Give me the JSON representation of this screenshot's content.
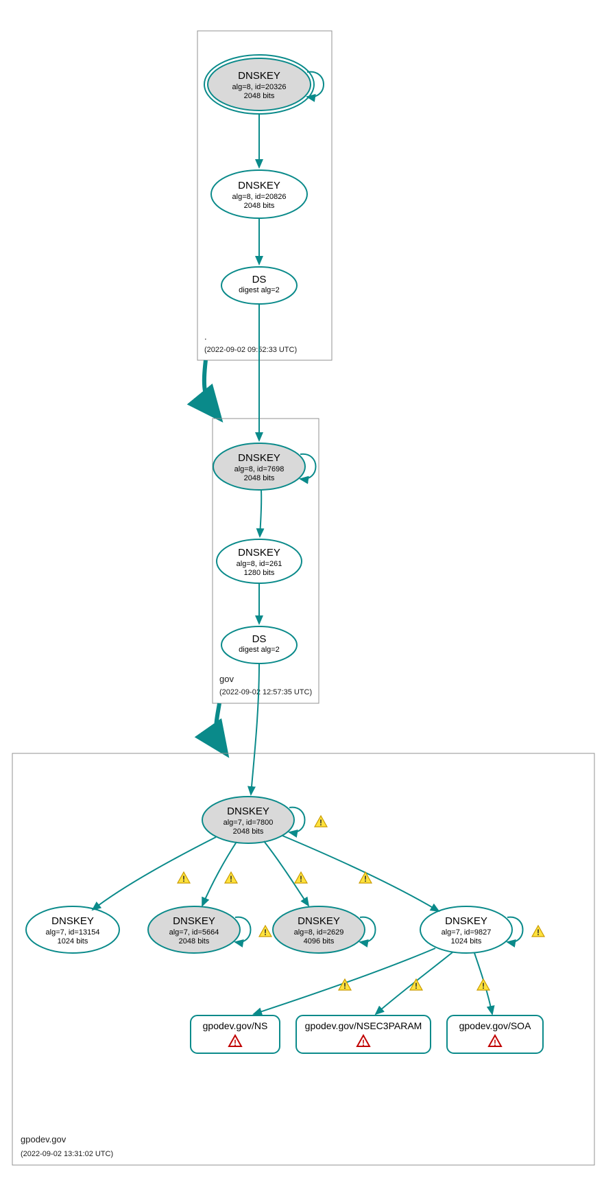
{
  "zones": {
    "root": {
      "name": ".",
      "timestamp": "(2022-09-02 09:52:33 UTC)"
    },
    "gov": {
      "name": "gov",
      "timestamp": "(2022-09-02 12:57:35 UTC)"
    },
    "domain": {
      "name": "gpodev.gov",
      "timestamp": "(2022-09-02 13:31:02 UTC)"
    }
  },
  "nodes": {
    "root_ksk": {
      "title": "DNSKEY",
      "line1": "alg=8, id=20326",
      "line2": "2048 bits"
    },
    "root_zsk": {
      "title": "DNSKEY",
      "line1": "alg=8, id=20826",
      "line2": "2048 bits"
    },
    "root_ds": {
      "title": "DS",
      "line1": "digest alg=2",
      "line2": ""
    },
    "gov_ksk": {
      "title": "DNSKEY",
      "line1": "alg=8, id=7698",
      "line2": "2048 bits"
    },
    "gov_zsk": {
      "title": "DNSKEY",
      "line1": "alg=8, id=261",
      "line2": "1280 bits"
    },
    "gov_ds": {
      "title": "DS",
      "line1": "digest alg=2",
      "line2": ""
    },
    "dom_ksk": {
      "title": "DNSKEY",
      "line1": "alg=7, id=7800",
      "line2": "2048 bits"
    },
    "dom_k1": {
      "title": "DNSKEY",
      "line1": "alg=7, id=13154",
      "line2": "1024 bits"
    },
    "dom_k2": {
      "title": "DNSKEY",
      "line1": "alg=7, id=5664",
      "line2": "2048 bits"
    },
    "dom_k3": {
      "title": "DNSKEY",
      "line1": "alg=8, id=2629",
      "line2": "4096 bits"
    },
    "dom_k4": {
      "title": "DNSKEY",
      "line1": "alg=7, id=9827",
      "line2": "1024 bits"
    }
  },
  "records": {
    "ns": {
      "label": "gpodev.gov/NS"
    },
    "nsec3": {
      "label": "gpodev.gov/NSEC3PARAM"
    },
    "soa": {
      "label": "gpodev.gov/SOA"
    }
  }
}
